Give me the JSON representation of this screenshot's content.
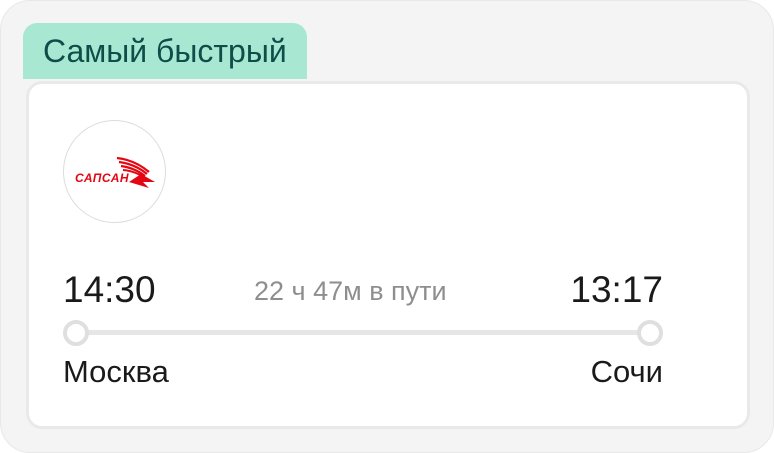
{
  "badge": {
    "label": "Самый быстрый"
  },
  "carrier": {
    "logo_text": "САПСАН",
    "logo_color": "#e30613",
    "logo_icon": "sapsan-logo-icon"
  },
  "trip": {
    "departure_time": "14:30",
    "duration": "22 ч 47м в пути",
    "arrival_time": "13:17",
    "departure_city": "Москва",
    "arrival_city": "Сочи"
  },
  "colors": {
    "badge_bg": "#a8e8d3",
    "badge_text": "#0e4d48",
    "duration_text": "#8e8e8e",
    "route_line": "#e6e6e6"
  }
}
